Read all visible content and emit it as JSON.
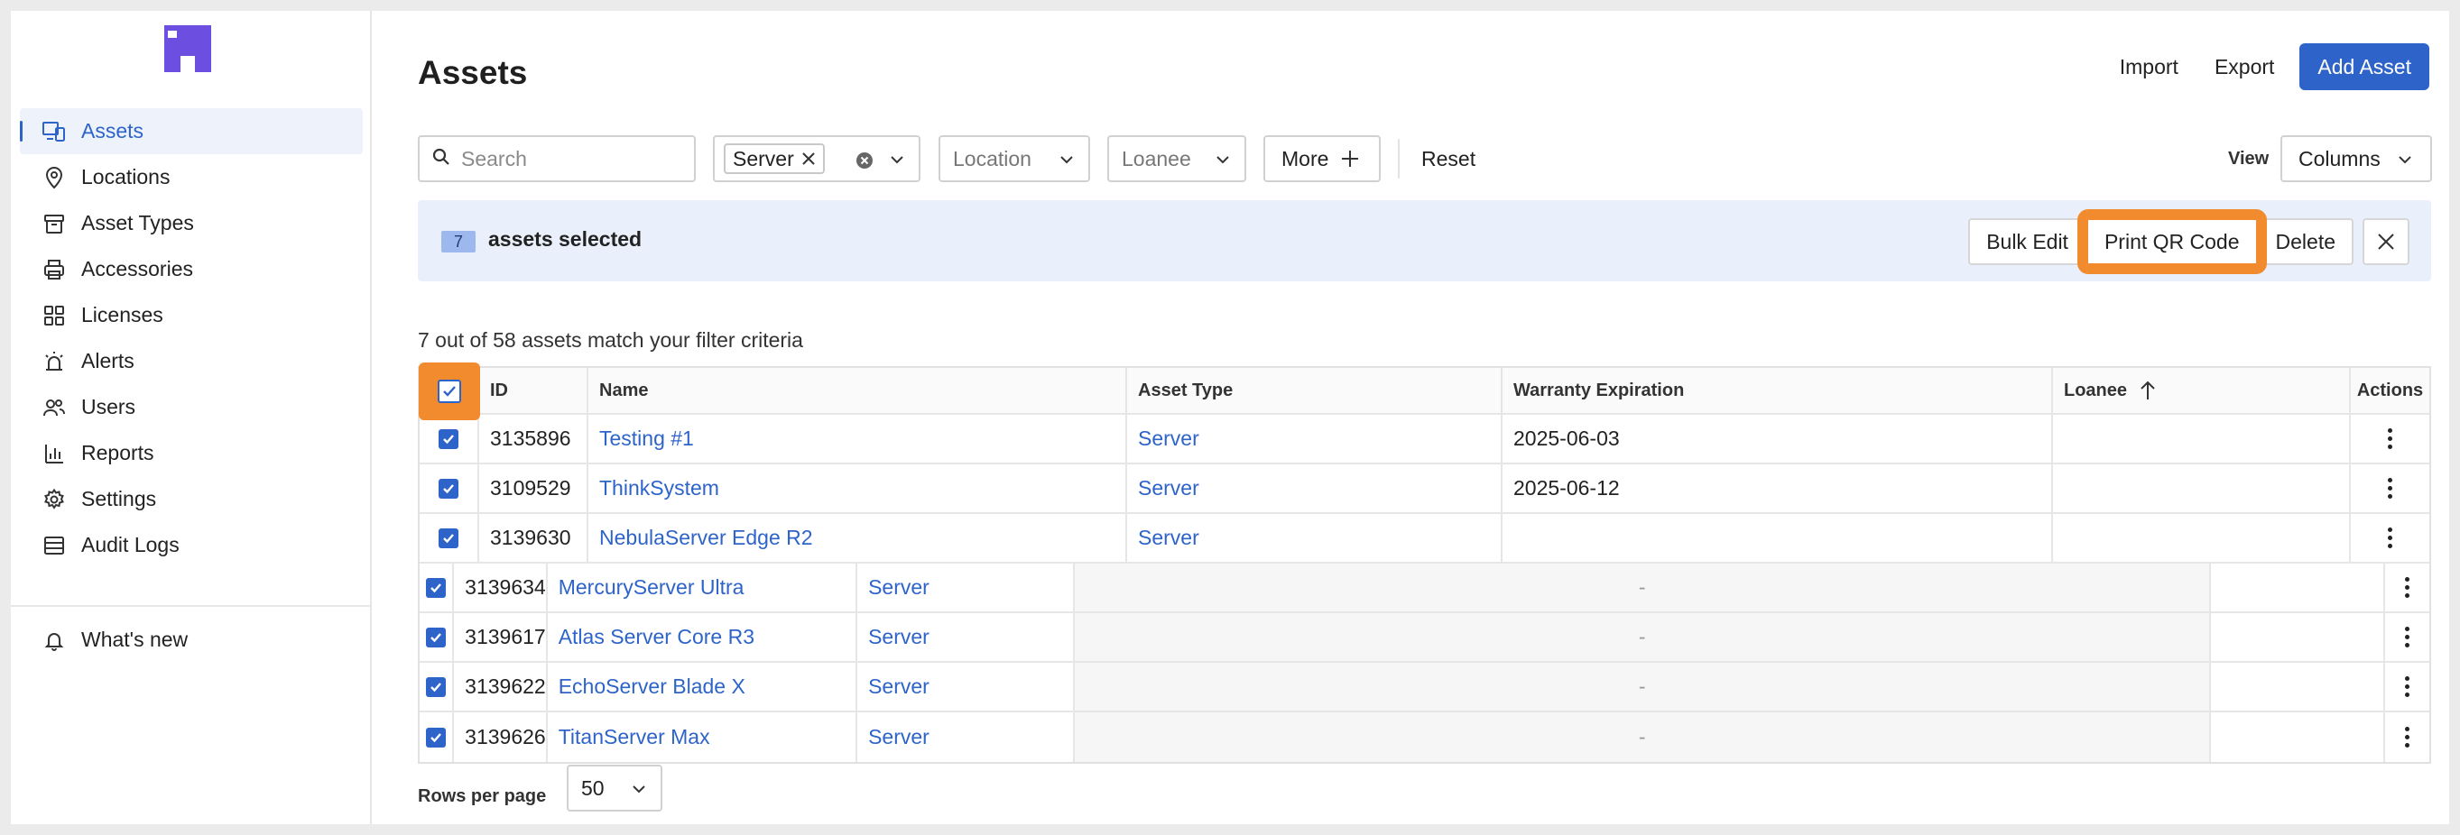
{
  "sidebar": {
    "nav": [
      {
        "label": "Assets",
        "icon": "assets-icon",
        "active": true
      },
      {
        "label": "Locations",
        "icon": "map-pin-icon"
      },
      {
        "label": "Asset Types",
        "icon": "box-icon"
      },
      {
        "label": "Accessories",
        "icon": "printer-icon"
      },
      {
        "label": "Licenses",
        "icon": "grid-icon"
      },
      {
        "label": "Alerts",
        "icon": "alarm-icon"
      },
      {
        "label": "Users",
        "icon": "users-icon"
      },
      {
        "label": "Reports",
        "icon": "bar-chart-icon"
      },
      {
        "label": "Settings",
        "icon": "gear-icon"
      },
      {
        "label": "Audit Logs",
        "icon": "list-icon"
      }
    ],
    "whats_new": "What's new"
  },
  "header": {
    "title": "Assets",
    "import": "Import",
    "export": "Export",
    "add": "Add Asset"
  },
  "filters": {
    "search_placeholder": "Search",
    "type_chip": "Server",
    "location": "Location",
    "loanee": "Loanee",
    "more": "More",
    "reset": "Reset",
    "view_label": "View",
    "view_value": "Columns"
  },
  "selection": {
    "count": "7",
    "text": "assets selected",
    "bulk_edit": "Bulk Edit",
    "print_qr": "Print QR Code",
    "delete": "Delete"
  },
  "match_text": "7 out of 58 assets match your filter criteria",
  "table": {
    "headers": {
      "id": "ID",
      "name": "Name",
      "type": "Asset Type",
      "warranty": "Warranty Expiration",
      "loanee": "Loanee",
      "actions": "Actions"
    },
    "rows": [
      {
        "id": "3135896",
        "name": "Testing #1",
        "type": "Server",
        "warranty": "2025-06-03",
        "loanee": ""
      },
      {
        "id": "3109529",
        "name": "ThinkSystem",
        "type": "Server",
        "warranty": "2025-06-12",
        "loanee": ""
      },
      {
        "id": "3139630",
        "name": "NebulaServer Edge R2",
        "type": "Server",
        "warranty": "",
        "loanee": ""
      },
      {
        "id": "3139634",
        "name": "MercuryServer Ultra",
        "type": "Server",
        "warranty": "-",
        "loanee": ""
      },
      {
        "id": "3139617",
        "name": "Atlas Server Core R3",
        "type": "Server",
        "warranty": "-",
        "loanee": ""
      },
      {
        "id": "3139622",
        "name": "EchoServer Blade X",
        "type": "Server",
        "warranty": "-",
        "loanee": ""
      },
      {
        "id": "3139626",
        "name": "TitanServer Max",
        "type": "Server",
        "warranty": "-",
        "loanee": ""
      }
    ]
  },
  "pagination": {
    "rows_label": "Rows per page",
    "rows_value": "50"
  },
  "colors": {
    "accent": "#2e64c9",
    "highlight": "#f28a2e",
    "logo": "#6c4fe0"
  }
}
